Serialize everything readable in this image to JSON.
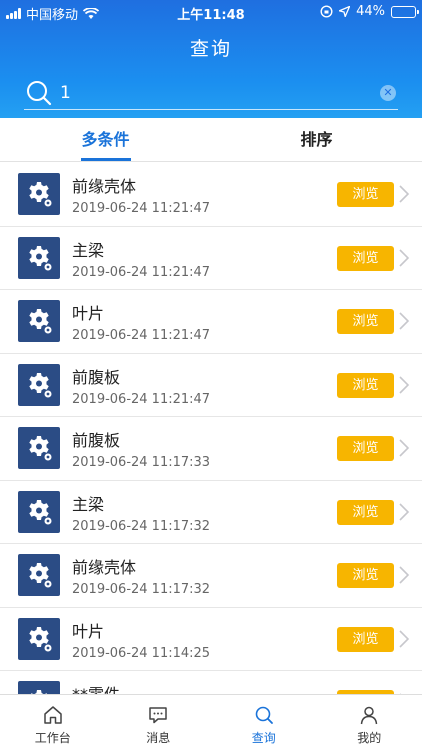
{
  "status_bar": {
    "carrier": "中国移动",
    "time": "上午11:48",
    "battery_percent": "44%",
    "battery_level": 0.44,
    "icons": [
      "signal-icon",
      "wifi-icon",
      "orientation-lock-icon",
      "location-icon",
      "battery-icon"
    ]
  },
  "header": {
    "title": "查询"
  },
  "search": {
    "value": "1",
    "placeholder": "",
    "clear_icon": "clear-icon"
  },
  "tabs": [
    {
      "label": "多条件",
      "active": true
    },
    {
      "label": "排序",
      "active": false
    }
  ],
  "list": {
    "item_icon": "gear-icon",
    "browse_label": "浏览",
    "items": [
      {
        "name": "前缘壳体",
        "time": "2019-06-24 11:21:47"
      },
      {
        "name": "主梁",
        "time": "2019-06-24 11:21:47"
      },
      {
        "name": "叶片",
        "time": "2019-06-24 11:21:47"
      },
      {
        "name": "前腹板",
        "time": "2019-06-24 11:21:47"
      },
      {
        "name": "前腹板",
        "time": "2019-06-24 11:17:33"
      },
      {
        "name": "主梁",
        "time": "2019-06-24 11:17:32"
      },
      {
        "name": "前缘壳体",
        "time": "2019-06-24 11:17:32"
      },
      {
        "name": "叶片",
        "time": "2019-06-24 11:14:25"
      },
      {
        "name": "**零件",
        "time": ""
      }
    ]
  },
  "tabbar": {
    "items": [
      {
        "label": "工作台",
        "icon": "home-icon",
        "active": false
      },
      {
        "label": "消息",
        "icon": "message-icon",
        "active": false
      },
      {
        "label": "查询",
        "icon": "search-icon",
        "active": true
      },
      {
        "label": "我的",
        "icon": "profile-icon",
        "active": false
      }
    ]
  },
  "colors": {
    "header_gradient_top": "#1f6fe0",
    "header_gradient_bottom": "#24a0f2",
    "accent": "#1a73d9",
    "browse_button": "#f7b500",
    "thumb_bg": "#2b4c85"
  }
}
